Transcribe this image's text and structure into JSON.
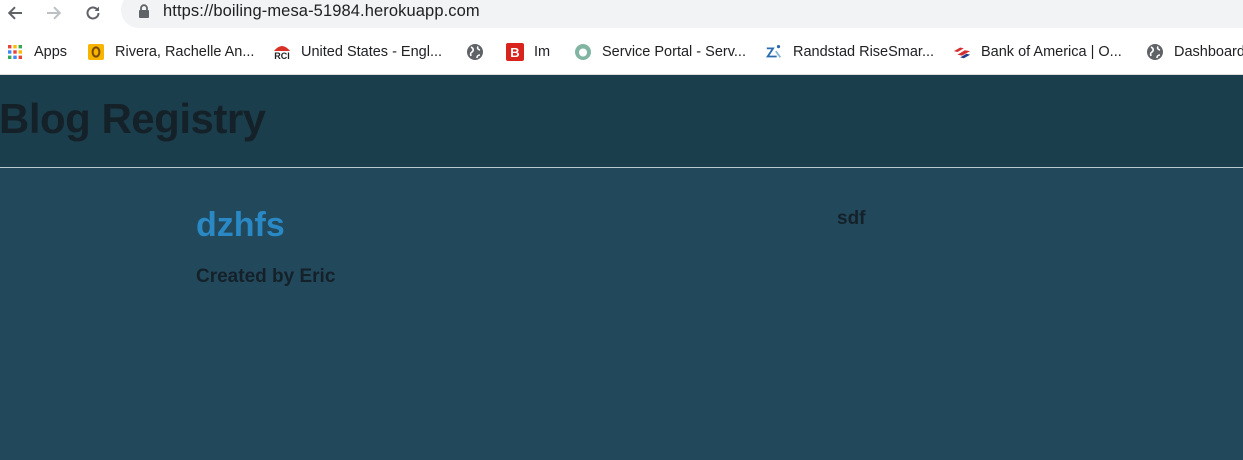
{
  "browser": {
    "url": "https://boiling-mesa-51984.herokuapp.com",
    "bookmarks": [
      {
        "label": "Apps",
        "icon": "apps-grid-icon"
      },
      {
        "label": "Rivera, Rachelle An...",
        "icon": "outlook-icon"
      },
      {
        "label": "United States - Engl...",
        "icon": "rci-icon"
      },
      {
        "label": "",
        "icon": "globe-icon"
      },
      {
        "label": "Im",
        "icon": "b-logo-icon"
      },
      {
        "label": "Service Portal - Serv...",
        "icon": "servicenow-icon"
      },
      {
        "label": "Randstad RiseSmar...",
        "icon": "risesmart-icon"
      },
      {
        "label": "Bank of America | O...",
        "icon": "bank-of-america-icon"
      },
      {
        "label": "Dashboard",
        "icon": "globe-icon"
      }
    ],
    "rci_icon_text": "RCI",
    "b_icon_text": "B"
  },
  "page": {
    "title": "Blog Registry",
    "post": {
      "title": "dzhfs",
      "author_line": "Created by Eric",
      "body": "sdf"
    }
  },
  "colors": {
    "header_bg": "#1b3e4d",
    "content_bg": "#22485c",
    "link": "#2a88c4",
    "dark_text": "#152129"
  }
}
